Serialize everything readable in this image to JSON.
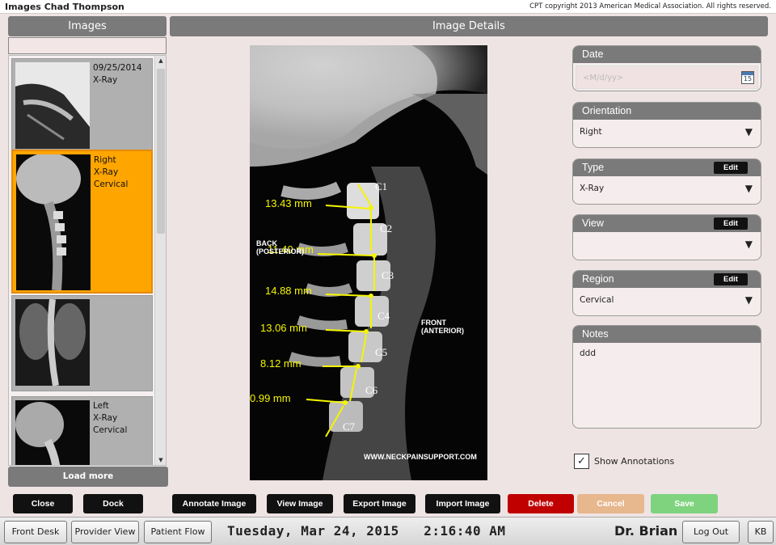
{
  "window": {
    "title": "Images Chad Thompson",
    "copyright": "CPT copyright 2013 American Medical Association. All rights reserved."
  },
  "images_panel": {
    "header": "Images",
    "load_more_label": "Load more",
    "thumbnails": [
      {
        "lines": [
          "09/25/2014",
          "X-Ray",
          ""
        ],
        "selected": false
      },
      {
        "lines": [
          "Right",
          "X-Ray",
          "Cervical"
        ],
        "selected": true
      },
      {
        "lines": [
          "",
          "",
          ""
        ],
        "selected": false
      },
      {
        "lines": [
          "Left",
          "X-Ray",
          "Cervical"
        ],
        "selected": false
      }
    ]
  },
  "details_panel": {
    "header": "Image Details",
    "xray": {
      "measurements": [
        "13.43 mm",
        "11.40 mm",
        "14.88 mm",
        "13.06 mm",
        "8.12 mm",
        "0.99 mm"
      ],
      "vertebrae": [
        "C1",
        "C2",
        "C3",
        "C4",
        "C5",
        "C6",
        "C7"
      ],
      "back_label_1": "BACK",
      "back_label_2": "(POSTERIOR)",
      "front_label_1": "FRONT",
      "front_label_2": "(ANTERIOR)",
      "watermark": "WWW.NECKPAINSUPPORT.COM",
      "annotation_color": "#f5f500"
    },
    "fields": {
      "date": {
        "label": "Date",
        "placeholder": "<M/d/yy>",
        "calendar_day": "15"
      },
      "orientation": {
        "label": "Orientation",
        "value": "Right"
      },
      "type": {
        "label": "Type",
        "value": "X-Ray",
        "edit_label": "Edit"
      },
      "view": {
        "label": "View",
        "value": "",
        "edit_label": "Edit"
      },
      "region": {
        "label": "Region",
        "value": "Cervical",
        "edit_label": "Edit"
      },
      "notes": {
        "label": "Notes",
        "value": "ddd"
      }
    },
    "show_annotations": {
      "label": "Show Annotations",
      "checked": true,
      "check_glyph": "✓"
    }
  },
  "actions": {
    "close": "Close",
    "dock": "Dock",
    "annotate": "Annotate Image",
    "view": "View Image",
    "export": "Export Image",
    "import": "Import Image",
    "delete": "Delete",
    "cancel": "Cancel",
    "save": "Save"
  },
  "bottom_bar": {
    "front_desk": "Front Desk",
    "provider_view": "Provider View",
    "patient_flow": "Patient Flow",
    "date": "Tuesday, Mar 24, 2015",
    "time": "2:16:40 AM",
    "user": "Dr. Brian",
    "log_out": "Log Out",
    "kb": "KB"
  },
  "colors": {
    "header_gray": "#7a7a7a",
    "selected_orange": "#ffa500",
    "delete_red": "#c00000",
    "cancel_tan": "#e7b78e",
    "save_green": "#7fd37f",
    "background": "#efe4e4"
  }
}
